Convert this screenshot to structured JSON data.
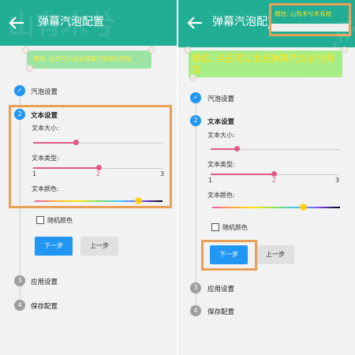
{
  "left": {
    "title": "弹幕汽泡配置",
    "bubble_text": "微信: 点击可以发送弹幕汽泡进行预览",
    "steps": [
      {
        "number": "1",
        "label": "汽泡设置",
        "state": "done"
      },
      {
        "number": "2",
        "label": "文本设置",
        "state": "active"
      },
      {
        "number": "3",
        "label": "应用设置",
        "state": "pending"
      },
      {
        "number": "4",
        "label": "保存配置",
        "state": "pending"
      }
    ],
    "text_size_label": "文本大小:",
    "text_size_value": 0.33,
    "text_type_label": "文本类型:",
    "text_type_ticks": [
      "1",
      "2",
      "3"
    ],
    "text_type_value": 2,
    "text_color_label": "文本颜色:",
    "text_color_position": 0.81,
    "random_color_label": "随机颜色",
    "random_color_checked": false,
    "next_label": "下一步",
    "prev_label": "上一步",
    "watermark": "山有木兮"
  },
  "right": {
    "title": "弹幕汽泡配置",
    "toast_text": "微信: 山有木兮木有枝",
    "bubble_text": "微信: 点击可以发送弹幕汽泡进行预览",
    "steps": [
      {
        "number": "1",
        "label": "汽泡设置",
        "state": "done"
      },
      {
        "number": "2",
        "label": "文本设置",
        "state": "active"
      },
      {
        "number": "3",
        "label": "应用设置",
        "state": "pending"
      },
      {
        "number": "4",
        "label": "保存配置",
        "state": "pending"
      }
    ],
    "text_size_label": "文本大小:",
    "text_size_value": 0.2,
    "text_type_label": "文本类型:",
    "text_type_ticks": [
      "1",
      "2",
      "3"
    ],
    "text_type_value": 2,
    "text_color_label": "文本颜色:",
    "text_color_position": 0.71,
    "random_color_label": "随机颜色",
    "random_color_checked": false,
    "next_label": "下一步",
    "prev_label": "上一步",
    "watermark": "山有木兮"
  },
  "colors": {
    "appbar": "#22ad95",
    "step_active": "#2196f3",
    "step_pending": "#9e9e9e",
    "slider": "#e05a84",
    "highlight": "#e9a056",
    "bubble_text": "#ffe21a"
  }
}
